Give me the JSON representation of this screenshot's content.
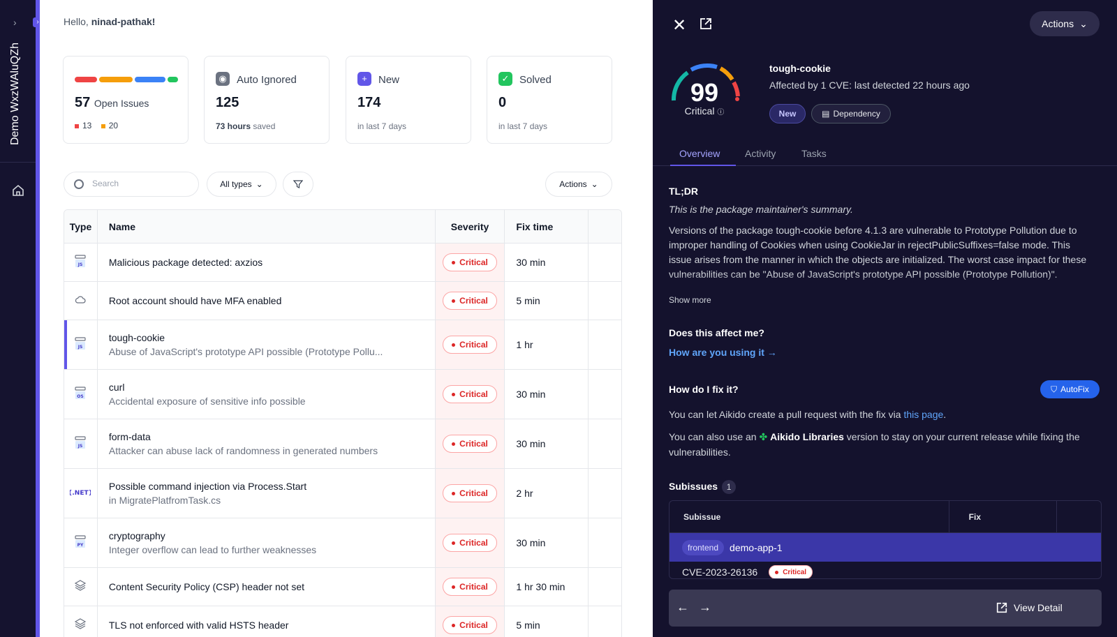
{
  "sidebar": {
    "workspace": "Demo WxzWAluQZh"
  },
  "greeting": {
    "prefix": "Hello, ",
    "user": "ninad-pathak!"
  },
  "cards": {
    "open": {
      "count": "57",
      "label": "Open Issues",
      "critical": "13",
      "high": "20"
    },
    "auto_ignored": {
      "label": "Auto Ignored",
      "count": "125",
      "sub_bold": "73 hours",
      "sub": " saved"
    },
    "new": {
      "label": "New",
      "count": "174",
      "sub": "in last 7 days"
    },
    "solved": {
      "label": "Solved",
      "count": "0",
      "sub": "in last 7 days"
    }
  },
  "colors": {
    "critical": "#ef4444",
    "high": "#f59e0b",
    "medium": "#3b82f6",
    "low": "#22c55e",
    "accent": "#6156e8"
  },
  "toolbar": {
    "search_placeholder": "Search",
    "types": "All types",
    "actions": "Actions"
  },
  "table": {
    "headers": {
      "type": "Type",
      "name": "Name",
      "severity": "Severity",
      "fix": "Fix time"
    },
    "rows": [
      {
        "icon": "js",
        "name": "Malicious package detected: axzios",
        "sub": "",
        "severity": "Critical",
        "fix": "30 min"
      },
      {
        "icon": "cloud",
        "name": "Root account should have MFA enabled",
        "sub": "",
        "severity": "Critical",
        "fix": "5 min"
      },
      {
        "icon": "js",
        "name": "tough-cookie",
        "sub": "Abuse of JavaScript's prototype API possible (Prototype Pollu...",
        "severity": "Critical",
        "fix": "1 hr"
      },
      {
        "icon": "os",
        "name": "curl",
        "sub": "Accidental exposure of sensitive info possible",
        "severity": "Critical",
        "fix": "30 min"
      },
      {
        "icon": "js",
        "name": "form-data",
        "sub": "Attacker can abuse lack of randomness in generated numbers",
        "severity": "Critical",
        "fix": "30 min"
      },
      {
        "icon": "net",
        "name": "Possible command injection via Process.Start",
        "sub": "in MigratePlatfromTask.cs",
        "severity": "Critical",
        "fix": "2 hr"
      },
      {
        "icon": "py",
        "name": "cryptography",
        "sub": "Integer overflow can lead to further weaknesses",
        "severity": "Critical",
        "fix": "30 min"
      },
      {
        "icon": "layers",
        "name": "Content Security Policy (CSP) header not set",
        "sub": "",
        "severity": "Critical",
        "fix": "1 hr 30 min"
      },
      {
        "icon": "layers",
        "name": "TLS not enforced with valid HSTS header",
        "sub": "",
        "severity": "Critical",
        "fix": "5 min"
      }
    ]
  },
  "panel": {
    "actions": "Actions",
    "score": "99",
    "score_label": "Critical",
    "title": "tough-cookie",
    "subtitle": "Affected by 1 CVE: last detected 22 hours ago",
    "tag_new": "New",
    "tag_dep": "Dependency",
    "tabs": [
      "Overview",
      "Activity",
      "Tasks"
    ],
    "tldr_title": "TL;DR",
    "tldr_italic": "This is the package maintainer's summary.",
    "tldr_text": "Versions of the package tough-cookie before 4.1.3 are vulnerable to Prototype Pollution due to improper handling of Cookies when using CookieJar in rejectPublicSuffixes=false mode. This issue arises from the manner in which the objects are initialized. The worst case impact for these vulnerabilities can be \"Abuse of JavaScript's prototype API possible (Prototype Pollution)\".",
    "show_more": "Show more",
    "affect_title": "Does this affect me?",
    "affect_link": "How are you using it →",
    "fix_title": "How do I fix it?",
    "autofix": "AutoFix",
    "fix_text1_a": "You can let Aikido create a pull request with the fix via ",
    "fix_text1_link": "this page",
    "fix_text1_b": ".",
    "fix_text2_a": "You can also use an ",
    "fix_text2_bold": "Aikido Libraries",
    "fix_text2_b": " version to stay on your current release while fixing the vulnerabilities.",
    "subissues_title": "Subissues",
    "subissues_count": "1",
    "sub_headers": {
      "subissue": "Subissue",
      "fix": "Fix"
    },
    "sub_tag": "frontend",
    "sub_app": "demo-app-1",
    "sub_cve": "CVE-2023-26136",
    "sub_sev": "Critical",
    "view_detail": "View Detail"
  }
}
